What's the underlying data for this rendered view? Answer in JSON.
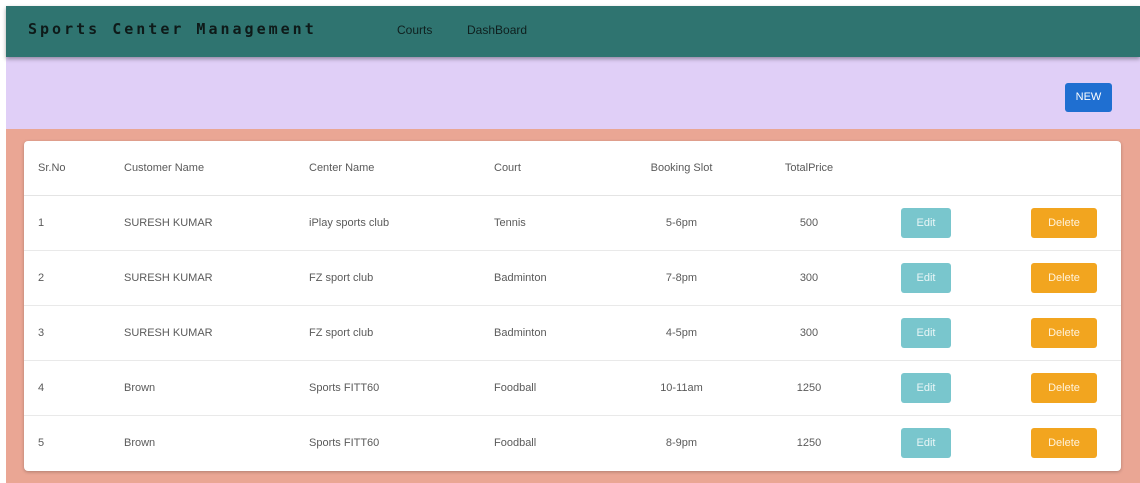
{
  "navbar": {
    "brand": "Sports Center Management",
    "links": [
      "Courts",
      "DashBoard"
    ]
  },
  "actions": {
    "new_label": "NEW"
  },
  "table": {
    "headers": [
      "Sr.No",
      "Customer Name",
      "Center Name",
      "Court",
      "Booking Slot",
      "TotalPrice"
    ],
    "edit_label": "Edit",
    "delete_label": "Delete",
    "rows": [
      {
        "sr": "1",
        "customer": "SURESH KUMAR",
        "center": "iPlay sports club",
        "court": "Tennis",
        "slot": "5-6pm",
        "price": "500"
      },
      {
        "sr": "2",
        "customer": "SURESH KUMAR",
        "center": "FZ sport club",
        "court": "Badminton",
        "slot": "7-8pm",
        "price": "300"
      },
      {
        "sr": "3",
        "customer": "SURESH KUMAR",
        "center": "FZ sport club",
        "court": "Badminton",
        "slot": "4-5pm",
        "price": "300"
      },
      {
        "sr": "4",
        "customer": "Brown",
        "center": "Sports FITT60",
        "court": "Foodball",
        "slot": "10-11am",
        "price": "1250"
      },
      {
        "sr": "5",
        "customer": "Brown",
        "center": "Sports FITT60",
        "court": "Foodball",
        "slot": "8-9pm",
        "price": "1250"
      }
    ]
  },
  "colors": {
    "navbar": "#2f7470",
    "action_band": "#e0cff7",
    "content_band": "#eaa694",
    "new_button": "#1f6fd1",
    "edit_button": "#79c6cd",
    "delete_button": "#f2a51f"
  }
}
